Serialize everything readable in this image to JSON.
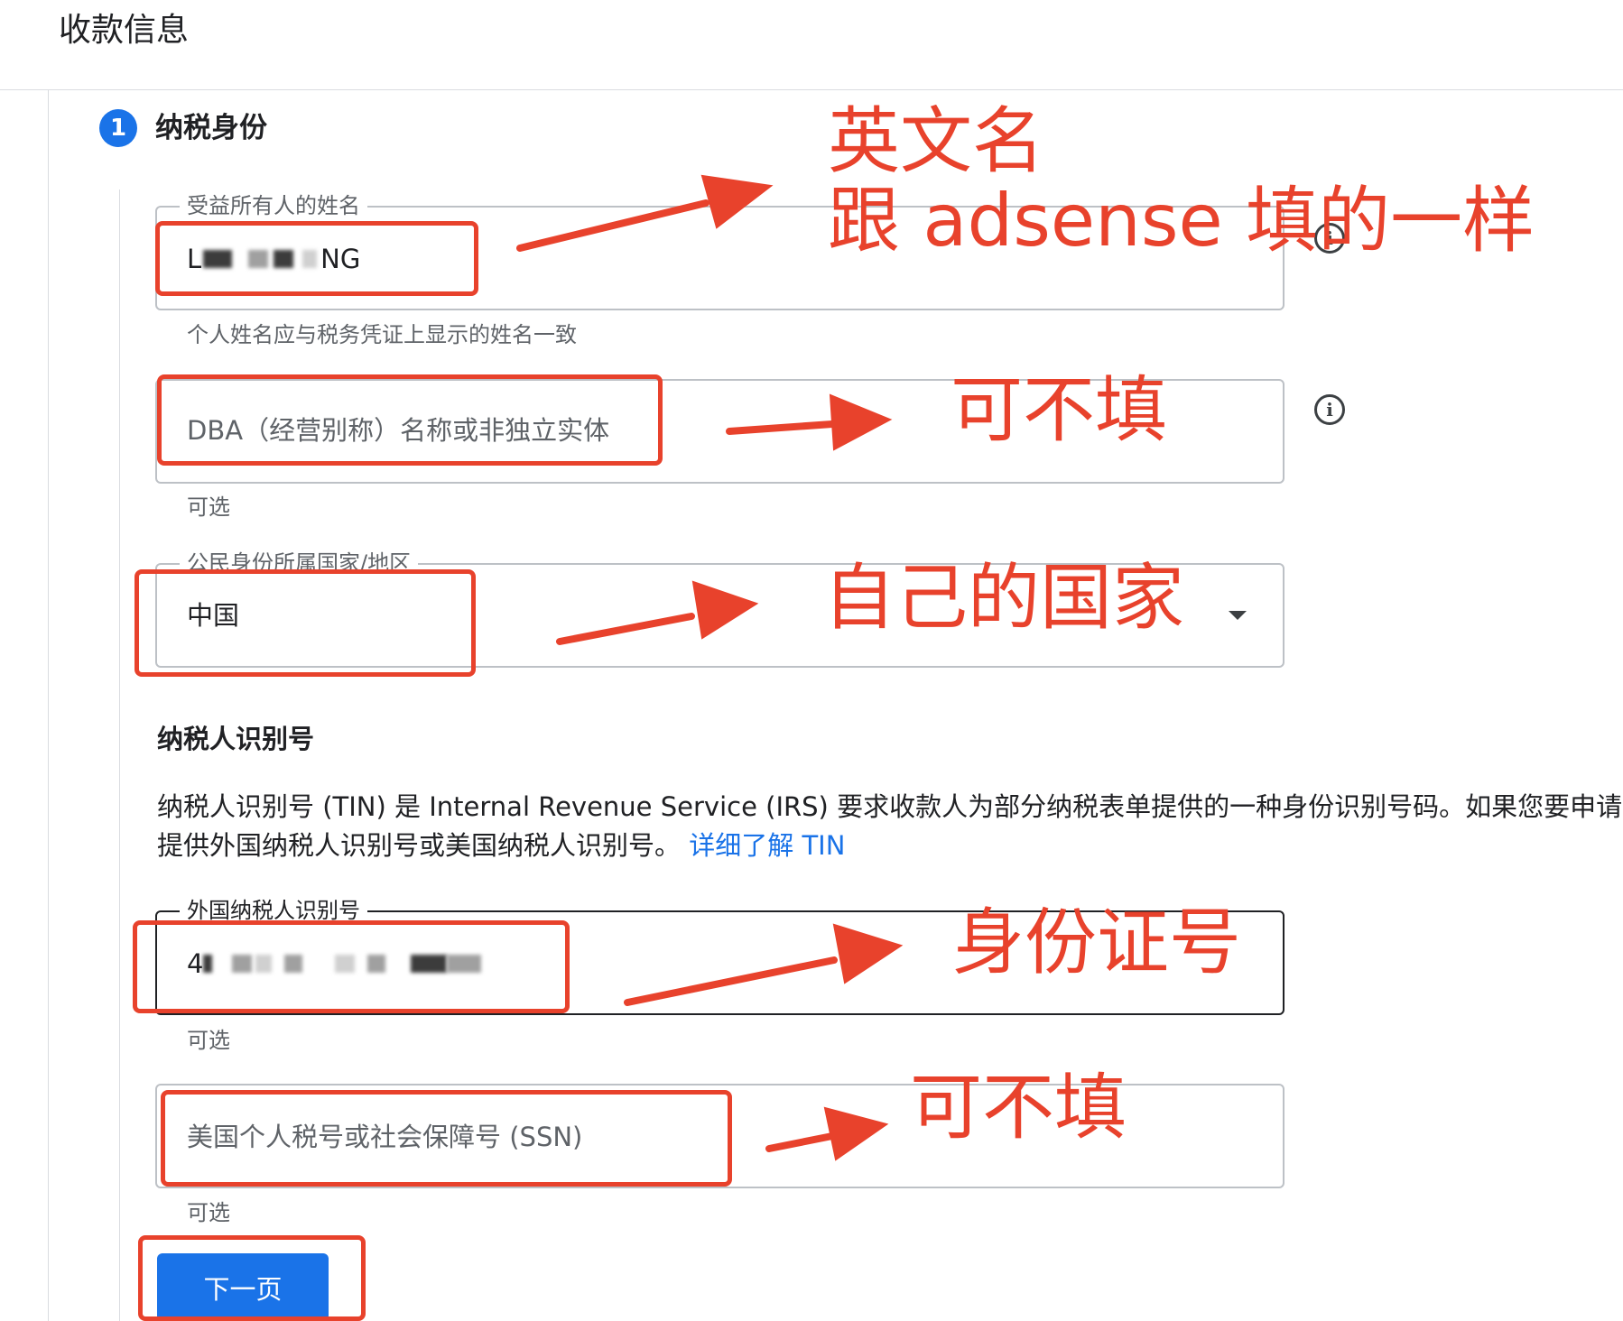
{
  "page": {
    "title": "收款信息"
  },
  "step": {
    "number": "1",
    "title": "纳税身份"
  },
  "fields": {
    "beneficiary": {
      "label": "受益所有人的姓名",
      "value_prefix": "L",
      "value_suffix": "NG",
      "helper": "个人姓名应与税务凭证上显示的姓名一致"
    },
    "dba": {
      "placeholder": "DBA（经营别称）名称或非独立实体",
      "helper": "可选"
    },
    "citizenship": {
      "label": "公民身份所属国家/地区",
      "value": "中国"
    },
    "foreign_tin": {
      "label": "外国纳税人识别号",
      "value_prefix": "4",
      "helper": "可选"
    },
    "ssn": {
      "placeholder": "美国个人税号或社会保障号 (SSN)",
      "helper": "可选"
    }
  },
  "tin_section": {
    "heading": "纳税人识别号",
    "line1": "纳税人识别号 (TIN) 是 Internal Revenue Service (IRS) 要求收款人为部分纳税表单提供的一种身份识别号码。如果您要申请享",
    "line2": "提供外国纳税人识别号或美国纳税人识别号。",
    "link": "详细了解 TIN"
  },
  "buttons": {
    "next": "下一页"
  },
  "annotations": {
    "name_line1": "英文名",
    "name_line2": "跟 adsense 填的一样",
    "optional_1": "可不填",
    "country": "自己的国家",
    "id_number": "身份证号",
    "optional_2": "可不填"
  },
  "colors": {
    "accent": "#1a73e8",
    "annotation_red": "#e8422c"
  }
}
